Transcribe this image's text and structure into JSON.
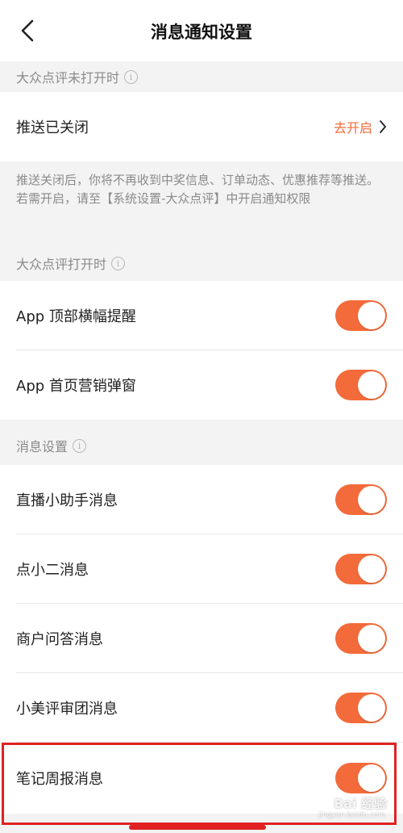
{
  "nav": {
    "title": "消息通知设置",
    "back_icon": "chevron-left-icon"
  },
  "sections": {
    "closed": {
      "header": "大众点评未打开时",
      "push_row": {
        "label": "推送已关闭",
        "action_label": "去开启",
        "action_icon": "chevron-right-icon"
      },
      "notice": "推送关闭后，你将不再收到中奖信息、订单动态、优惠推荐等推送。若需开启，请至【系统设置-大众点评】中开启通知权限"
    },
    "open": {
      "header": "大众点评打开时",
      "items": [
        {
          "label": "App 顶部横幅提醒",
          "enabled": true
        },
        {
          "label": "App 首页营销弹窗",
          "enabled": true
        }
      ]
    },
    "messages": {
      "header": "消息设置",
      "items": [
        {
          "label": "直播小助手消息",
          "enabled": true
        },
        {
          "label": "点小二消息",
          "enabled": true
        },
        {
          "label": "商户问答消息",
          "enabled": true
        },
        {
          "label": "小美评审团消息",
          "enabled": true
        },
        {
          "label": "笔记周报消息",
          "enabled": true
        }
      ]
    }
  },
  "watermark": {
    "text": "Bai 经验",
    "sub": "jingyan.baidu.com"
  },
  "colors": {
    "accent": "#f36b3a",
    "highlight": "#e02222",
    "background": "#f3f3f3"
  }
}
